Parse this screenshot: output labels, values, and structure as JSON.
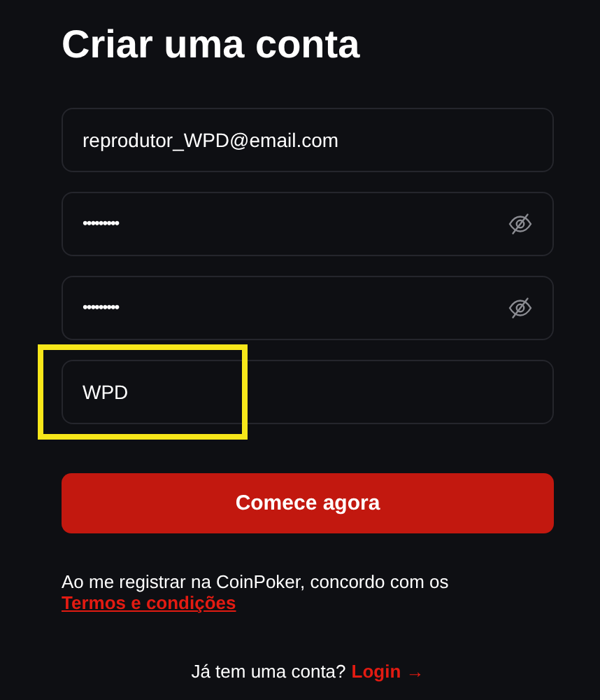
{
  "title": "Criar uma conta",
  "fields": [
    {
      "kind": "text",
      "value": "reprodutor_WPD@email.com",
      "highlighted": false
    },
    {
      "kind": "password",
      "value": "•••••••••",
      "highlighted": false
    },
    {
      "kind": "password",
      "value": "•••••••••",
      "highlighted": false
    },
    {
      "kind": "text",
      "value": "WPD",
      "highlighted": true
    }
  ],
  "submit_button": "Comece agora",
  "terms": {
    "text": "Ao me registrar na CoinPoker, concordo com os ",
    "link": "Termos e condições"
  },
  "login": {
    "text": "Já tem uma conta?",
    "link": "Login",
    "arrow": "→"
  }
}
